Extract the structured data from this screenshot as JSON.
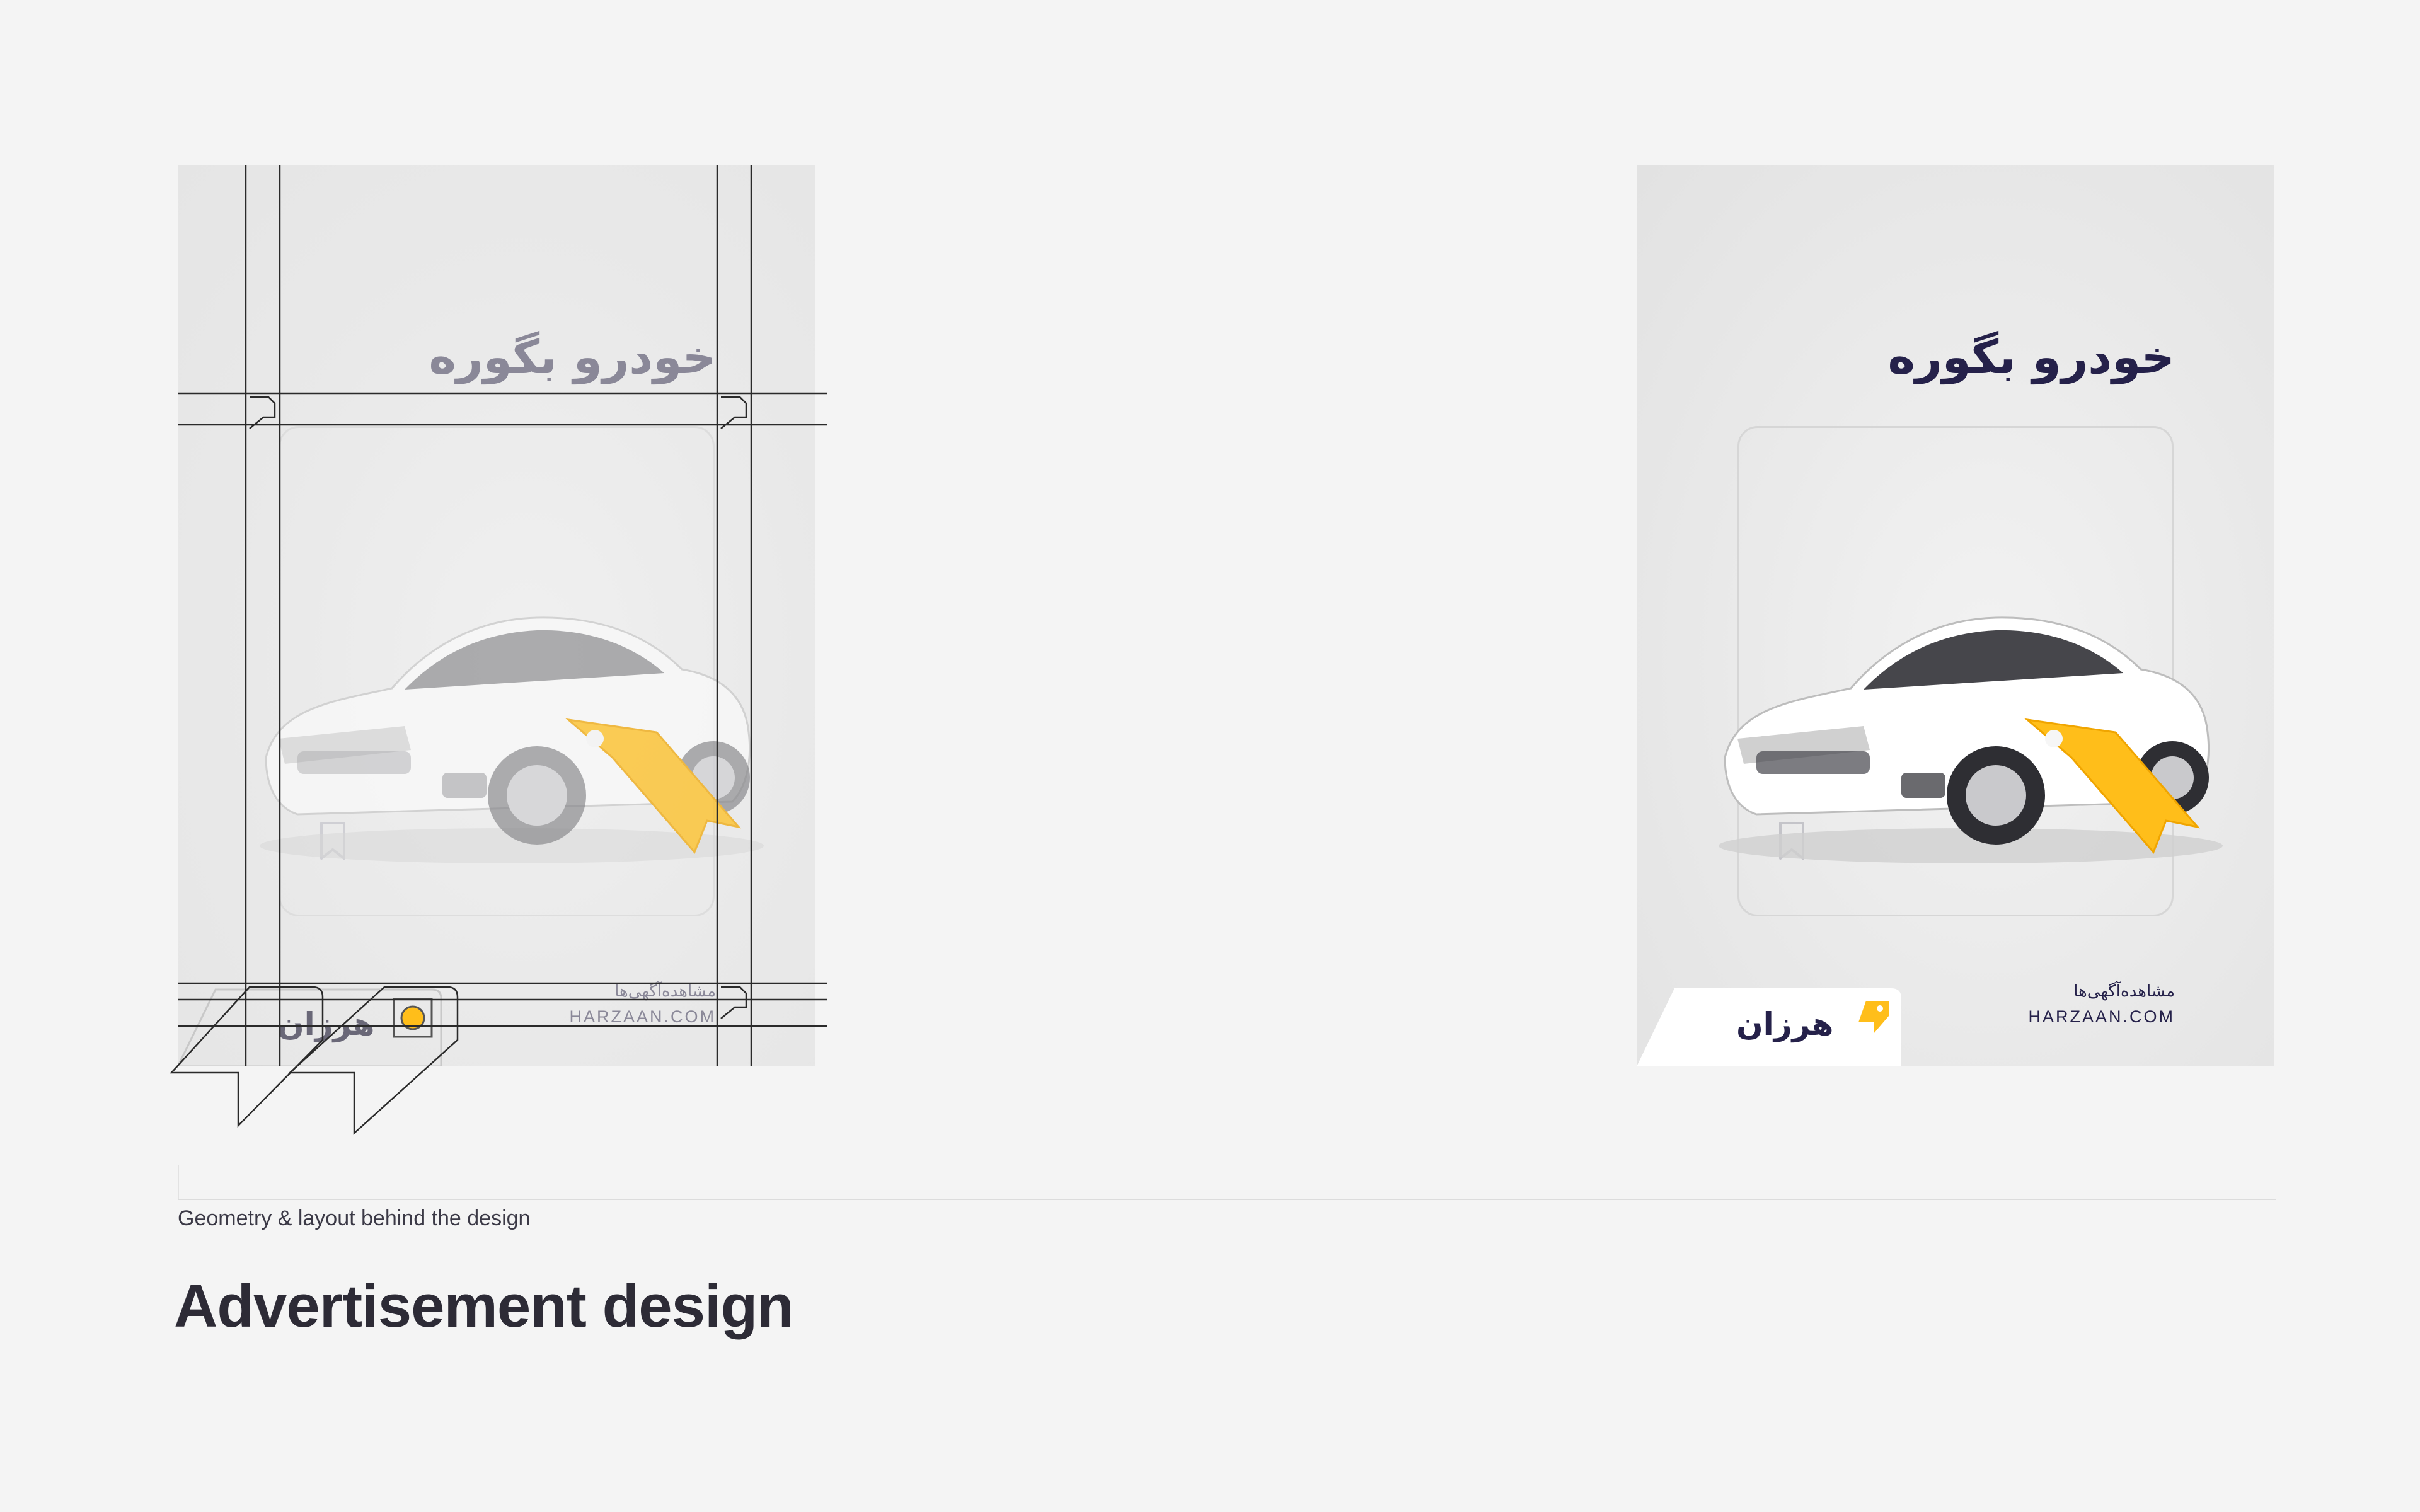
{
  "poster": {
    "headline": "خودرو بگوره",
    "view_ads": "مشاهده‌آگهی‌ها",
    "url": "HARZAAN.COM",
    "brand_wordmark": "هرزان"
  },
  "caption": {
    "geometry_note": "Geometry & layout behind the design",
    "section_title": "Advertisement design"
  },
  "colors": {
    "background": "#f4f4f4",
    "brand_navy": "#25214a",
    "brand_yellow": "#ffbe1a",
    "muted_text": "#8a8898"
  },
  "icons": [
    "bookmark-icon",
    "price-tag-icon",
    "brand-logo-icon",
    "car-image"
  ]
}
